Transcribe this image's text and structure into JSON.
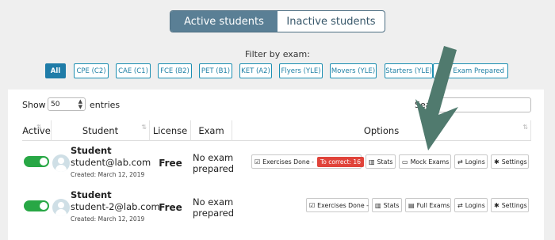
{
  "segmented": {
    "active": "Active students",
    "inactive": "Inactive students"
  },
  "filter": {
    "title": "Filter by exam:",
    "chips": [
      "All",
      "CPE (C2)",
      "CAE (C1)",
      "FCE (B2)",
      "PET (B1)",
      "KET (A2)",
      "Flyers (YLE)",
      "Movers (YLE)",
      "Starters (YLE)",
      "No Exam Prepared"
    ]
  },
  "table_controls": {
    "show": "Show",
    "entries_value": "50",
    "entries": "entries",
    "search": "Search:"
  },
  "columns": [
    "Active",
    "Student",
    "License",
    "Exam",
    "Options"
  ],
  "rows": [
    {
      "name": "Student",
      "email": "student@lab.com",
      "created": "Created: March 12, 2019",
      "license": "Free",
      "exam_line1": "No exam",
      "exam_line2": "prepared",
      "exercises": "Exercises Done -",
      "to_correct": "To correct: 16",
      "stats": "Stats",
      "exams_btn": "Mock Exams",
      "logins": "Logins",
      "settings": "Settings"
    },
    {
      "name": "Student",
      "email": "student-2@lab.com",
      "created": "Created: March 12, 2019",
      "license": "Free",
      "exam_line1": "No exam",
      "exam_line2": "prepared",
      "exercises": "Exercises Done -",
      "stats": "Stats",
      "exams_btn": "Full Exams",
      "logins": "Logins",
      "settings": "Settings"
    }
  ],
  "colors": {
    "accent": "#5a7f95",
    "chip": "#1f7ca8",
    "toggle_on": "#28a745",
    "badge": "#e0433a",
    "arrow": "#507a6e"
  }
}
